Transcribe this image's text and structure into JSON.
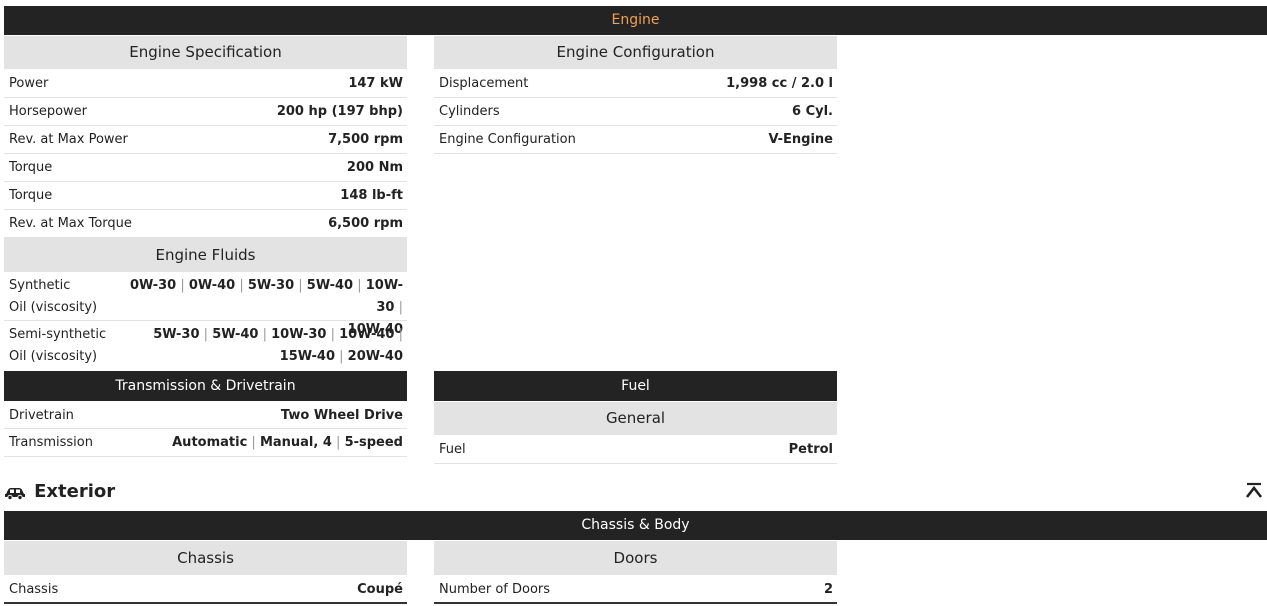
{
  "engine": {
    "title": "Engine",
    "title_color": "#f0a050",
    "specification": {
      "heading": "Engine Specification",
      "rows": [
        {
          "label": "Power",
          "value": "147 kW"
        },
        {
          "label": "Horsepower",
          "value": "200 hp (197 bhp)"
        },
        {
          "label": "Rev. at Max Power",
          "value": "7,500 rpm"
        },
        {
          "label": "Torque",
          "value": "200 Nm"
        },
        {
          "label": "Torque",
          "value": "148 lb-ft"
        },
        {
          "label": "Rev. at Max Torque",
          "value": "6,500 rpm"
        }
      ]
    },
    "configuration": {
      "heading": "Engine Configuration",
      "rows": [
        {
          "label": "Displacement",
          "value": "1,998 cc / 2.0 l"
        },
        {
          "label": "Cylinders",
          "value": "6 Cyl."
        },
        {
          "label": "Engine Configuration",
          "value": "V-Engine"
        }
      ]
    },
    "fluids": {
      "heading": "Engine Fluids",
      "synthetic": {
        "label_line1": "Synthetic",
        "label_line2": "Oil (viscosity)",
        "values": [
          "0W-30",
          "0W-40",
          "5W-30",
          "5W-40",
          "10W-30",
          "10W-40"
        ]
      },
      "semi_synthetic": {
        "label_line1": "Semi-synthetic",
        "label_line2": "Oil (viscosity)",
        "values": [
          "5W-30",
          "5W-40",
          "10W-30",
          "10W-40",
          "15W-40",
          "20W-40"
        ]
      }
    }
  },
  "transmission": {
    "heading": "Transmission & Drivetrain",
    "drivetrain": {
      "label": "Drivetrain",
      "value": "Two Wheel Drive"
    },
    "transmission": {
      "label": "Transmission",
      "values": [
        "Automatic",
        "Manual, 4",
        "5-speed"
      ]
    }
  },
  "fuel": {
    "heading": "Fuel",
    "subheading": "General",
    "row": {
      "label": "Fuel",
      "value": "Petrol"
    }
  },
  "exterior": {
    "title": "Exterior",
    "icon": "car-icon",
    "scroll_top_icon": "scroll-to-top-icon",
    "chassis_body": {
      "heading": "Chassis & Body",
      "chassis": {
        "heading": "Chassis",
        "label": "Chassis",
        "value": "Coupé"
      },
      "doors": {
        "heading": "Doors",
        "label": "Number of Doors",
        "value": "2"
      }
    }
  }
}
